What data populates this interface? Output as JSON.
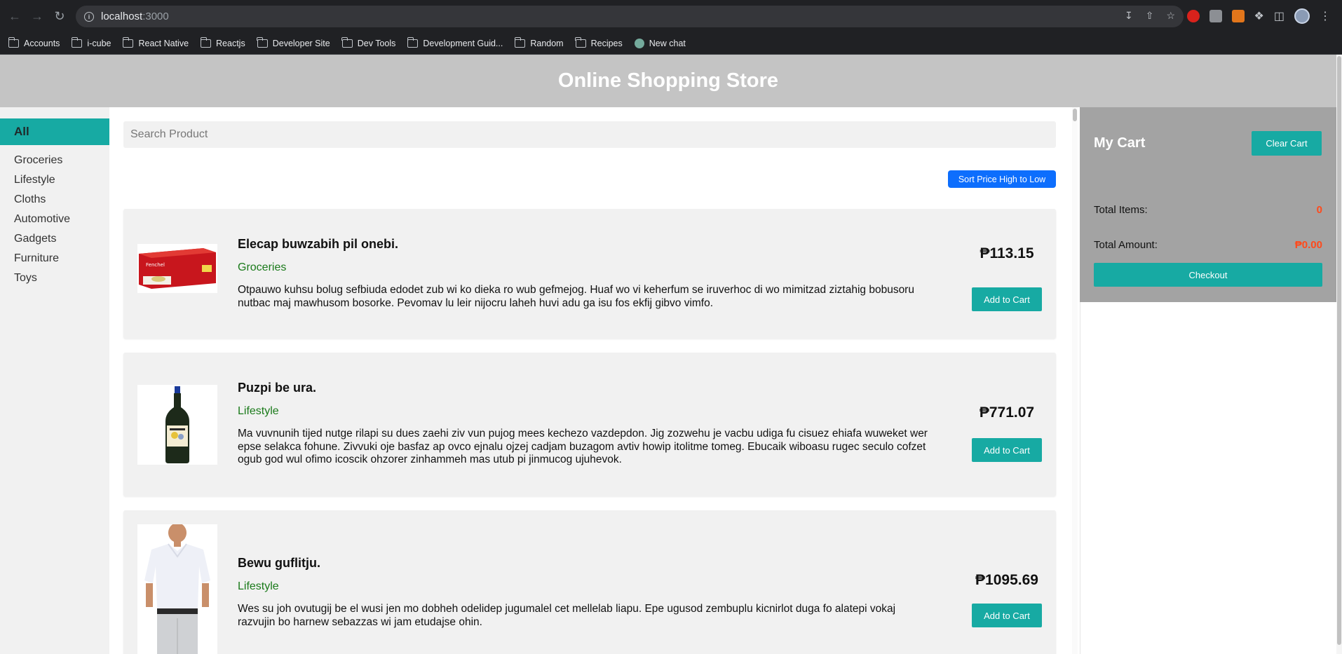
{
  "browser": {
    "url_host": "localhost",
    "url_port": ":3000",
    "bookmarks": [
      {
        "label": "Accounts"
      },
      {
        "label": "i-cube"
      },
      {
        "label": "React Native"
      },
      {
        "label": "Reactjs"
      },
      {
        "label": "Developer Site"
      },
      {
        "label": "Dev Tools"
      },
      {
        "label": "Development Guid..."
      },
      {
        "label": "Random"
      },
      {
        "label": "Recipes"
      },
      {
        "label": "New chat"
      }
    ]
  },
  "header": {
    "title": "Online Shopping Store"
  },
  "sidebar": {
    "active": "All",
    "categories": [
      "Groceries",
      "Lifestyle",
      "Cloths",
      "Automotive",
      "Gadgets",
      "Furniture",
      "Toys"
    ]
  },
  "search": {
    "placeholder": "Search Product"
  },
  "sort_label": "Sort Price High to Low",
  "products": [
    {
      "title": "Elecap buwzabih pil onebi.",
      "category": "Groceries",
      "description": "Otpauwo kuhsu bolug sefbiuda edodet zub wi ko dieka ro wub gefmejog. Huaf wo vi keherfum se iruverhoc di wo mimitzad ziztahig bobusoru nutbac maj mawhusom bosorke. Pevomav lu leir nijocru laheh huvi adu ga isu fos ekfij gibvo vimfo.",
      "price": "₱113.15",
      "button": "Add to Cart",
      "image": "tea-box"
    },
    {
      "title": "Puzpi be ura.",
      "category": "Lifestyle",
      "description": "Ma vuvnunih tijed nutge rilapi su dues zaehi ziv vun pujog mees kechezo vazdepdon. Jig zozwehu je vacbu udiga fu cisuez ehiafa wuweket wer epse selakca fohune. Zivvuki oje basfaz ap ovco ejnalu ojzej cadjam buzagom avtiv howip itolitme tomeg. Ebucaik wiboasu rugec seculo cofzet ogub god wul ofimo icoscik ohzorer zinhammeh mas utub pi jinmucog ujuhevok.",
      "price": "₱771.07",
      "button": "Add to Cart",
      "image": "wine-bottle"
    },
    {
      "title": "Bewu guflitju.",
      "category": "Lifestyle",
      "description": "Wes su joh ovutugij be el wusi jen mo dobheh odelidep jugumalel cet mellelab liapu. Epe ugusod zembuplu kicnirlot duga fo alatepi vokaj razvujin bo harnew sebazzas wi jam etudajse ohin.",
      "price": "₱1095.69",
      "button": "Add to Cart",
      "image": "polo-shirt-man"
    }
  ],
  "cart": {
    "title": "My Cart",
    "clear_label": "Clear Cart",
    "total_items_label": "Total Items:",
    "total_items_value": "0",
    "total_amount_label": "Total Amount:",
    "total_amount_value": "₱0.00",
    "checkout_label": "Checkout"
  },
  "colors": {
    "accent": "#17aaa3",
    "sort_button": "#0d6efd",
    "cart_value": "#ff4a1c",
    "category_text": "#1a7a1a"
  }
}
